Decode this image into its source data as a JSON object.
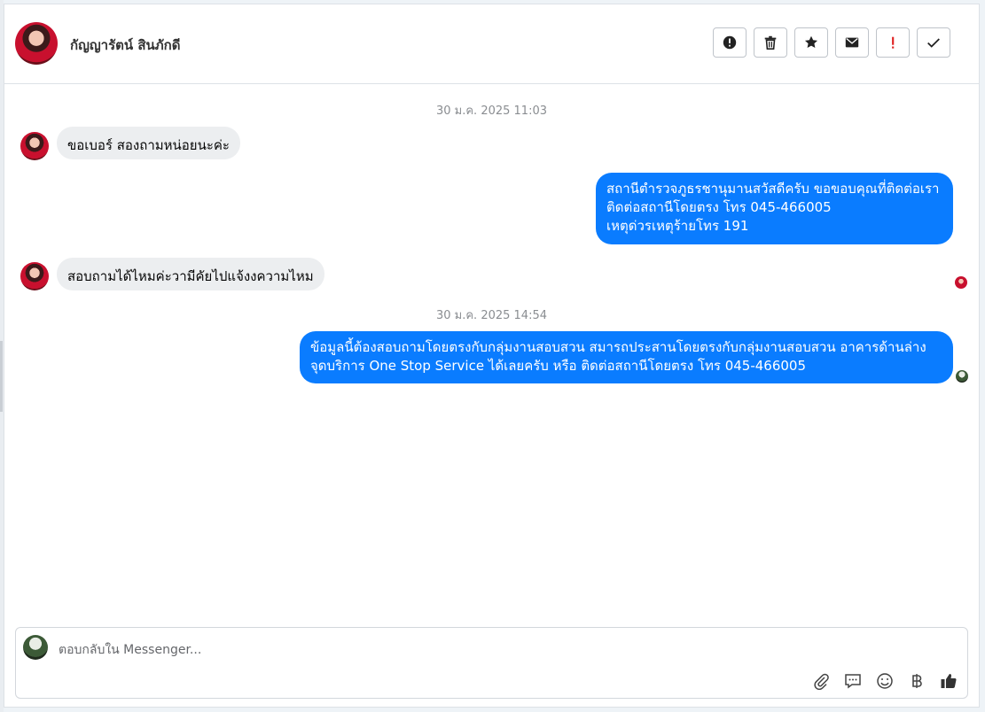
{
  "conversation": {
    "contact_name": "กัญญารัตน์ สินภักดี"
  },
  "header_actions": [
    {
      "name": "report-icon-button",
      "icon": "alert-circle-icon"
    },
    {
      "name": "delete-button",
      "icon": "trash-icon"
    },
    {
      "name": "star-button",
      "icon": "star-icon"
    },
    {
      "name": "mark-unread-button",
      "icon": "envelope-icon"
    },
    {
      "name": "important-button",
      "icon": "exclamation-icon"
    },
    {
      "name": "mark-done-button",
      "icon": "check-icon"
    }
  ],
  "messages": {
    "ts1": "30 ม.ค. 2025 11:03",
    "m1": "ขอเบอร์  สองถามหน่อยนะค่ะ",
    "m2_line1": "สถานีตำรวจภูธรชานุมานสวัสดีครับ ขอขอบคุณที่ติดต่อเรา",
    "m2_line2": "ติดต่อสถานีโดยตรง โทร 045-466005",
    "m2_line3": "เหตุด่วรเหตุร้ายโทร 191",
    "m3": "สอบถามได้ไหมค่ะวามีคัยไปแจ้งงความไหม",
    "ts2": "30 ม.ค. 2025 14:54",
    "m4_line1": "ข้อมูลนี้ต้องสอบถามโดยตรงกับกลุ่มงานสอบสวน สมารถประสานโดยตรงกับกลุ่มงานสอบสวน อาคารด้านล่าง",
    "m4_line2": "จุดบริการ One Stop Service ได้เลยครับ หรือ ติดต่อสถานีโดยตรง โทร 045-466005"
  },
  "composer": {
    "placeholder": "ตอบกลับใน Messenger..."
  },
  "colors": {
    "outgoing_bubble": "#0a7cff",
    "incoming_bubble": "#eceef0",
    "important_red": "#e02424"
  }
}
